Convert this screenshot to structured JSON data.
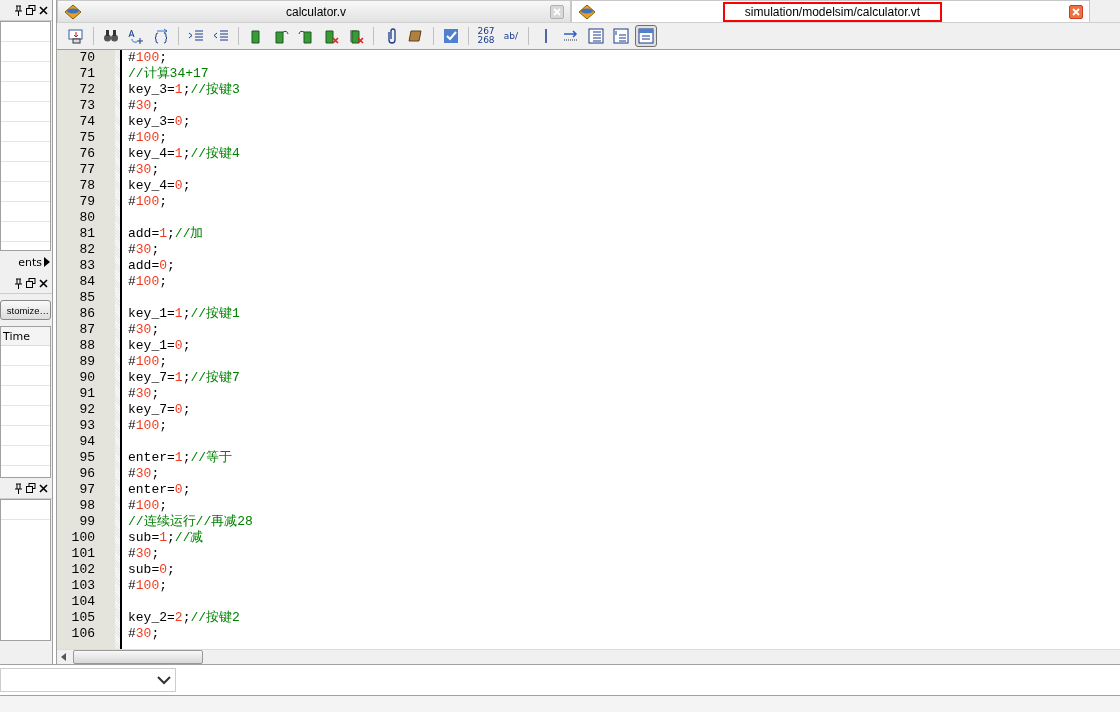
{
  "left_panel": {
    "tabs_fragment": "ents",
    "customize_button": "stomize…",
    "table_header": "Time"
  },
  "tabs": [
    {
      "label": "calculator.v",
      "selected": false,
      "outlined": false
    },
    {
      "label": "simulation/modelsim/calculator.vt",
      "selected": true,
      "outlined": true
    }
  ],
  "toolbar": [
    {
      "kind": "import"
    },
    {
      "kind": "sep"
    },
    {
      "kind": "find"
    },
    {
      "kind": "replace"
    },
    {
      "kind": "braces"
    },
    {
      "kind": "sep"
    },
    {
      "kind": "indent"
    },
    {
      "kind": "outdent"
    },
    {
      "kind": "sep"
    },
    {
      "kind": "bookmark"
    },
    {
      "kind": "bookmark-next"
    },
    {
      "kind": "bookmark-prev"
    },
    {
      "kind": "bookmark-delete"
    },
    {
      "kind": "bookmark-clear"
    },
    {
      "kind": "sep"
    },
    {
      "kind": "attach"
    },
    {
      "kind": "scroll"
    },
    {
      "kind": "sep"
    },
    {
      "kind": "check"
    },
    {
      "kind": "sep"
    },
    {
      "kind": "text",
      "label": "267\n268"
    },
    {
      "kind": "text",
      "label": "ab/"
    },
    {
      "kind": "sep"
    },
    {
      "kind": "bar"
    },
    {
      "kind": "arrow"
    },
    {
      "kind": "lines"
    },
    {
      "kind": "lines-numbered"
    },
    {
      "kind": "view",
      "selected": true
    }
  ],
  "code_lines": [
    {
      "number": "70",
      "tokens": [
        {
          "kind": "plain",
          "text": "#"
        },
        {
          "kind": "num",
          "text": "100"
        },
        {
          "kind": "plain",
          "text": ";"
        }
      ]
    },
    {
      "number": "71",
      "tokens": [
        {
          "kind": "comment",
          "text": "//计算34+17"
        }
      ]
    },
    {
      "number": "72",
      "tokens": [
        {
          "kind": "plain",
          "text": "key_3="
        },
        {
          "kind": "num",
          "text": "1"
        },
        {
          "kind": "plain",
          "text": ";"
        },
        {
          "kind": "comment",
          "text": "//按键3"
        }
      ]
    },
    {
      "number": "73",
      "tokens": [
        {
          "kind": "plain",
          "text": "#"
        },
        {
          "kind": "num",
          "text": "30"
        },
        {
          "kind": "plain",
          "text": ";"
        }
      ]
    },
    {
      "number": "74",
      "tokens": [
        {
          "kind": "plain",
          "text": "key_3="
        },
        {
          "kind": "num",
          "text": "0"
        },
        {
          "kind": "plain",
          "text": ";"
        }
      ]
    },
    {
      "number": "75",
      "tokens": [
        {
          "kind": "plain",
          "text": "#"
        },
        {
          "kind": "num",
          "text": "100"
        },
        {
          "kind": "plain",
          "text": ";"
        }
      ]
    },
    {
      "number": "76",
      "tokens": [
        {
          "kind": "plain",
          "text": "key_4="
        },
        {
          "kind": "num",
          "text": "1"
        },
        {
          "kind": "plain",
          "text": ";"
        },
        {
          "kind": "comment",
          "text": "//按键4"
        }
      ]
    },
    {
      "number": "77",
      "tokens": [
        {
          "kind": "plain",
          "text": "#"
        },
        {
          "kind": "num",
          "text": "30"
        },
        {
          "kind": "plain",
          "text": ";"
        }
      ]
    },
    {
      "number": "78",
      "tokens": [
        {
          "kind": "plain",
          "text": "key_4="
        },
        {
          "kind": "num",
          "text": "0"
        },
        {
          "kind": "plain",
          "text": ";"
        }
      ]
    },
    {
      "number": "79",
      "tokens": [
        {
          "kind": "plain",
          "text": "#"
        },
        {
          "kind": "num",
          "text": "100"
        },
        {
          "kind": "plain",
          "text": ";"
        }
      ]
    },
    {
      "number": "80"
    },
    {
      "number": "81",
      "tokens": [
        {
          "kind": "plain",
          "text": "add="
        },
        {
          "kind": "num",
          "text": "1"
        },
        {
          "kind": "plain",
          "text": ";"
        },
        {
          "kind": "comment",
          "text": "//加"
        }
      ]
    },
    {
      "number": "82",
      "tokens": [
        {
          "kind": "plain",
          "text": "#"
        },
        {
          "kind": "num",
          "text": "30"
        },
        {
          "kind": "plain",
          "text": ";"
        }
      ]
    },
    {
      "number": "83",
      "tokens": [
        {
          "kind": "plain",
          "text": "add="
        },
        {
          "kind": "num",
          "text": "0"
        },
        {
          "kind": "plain",
          "text": ";"
        }
      ]
    },
    {
      "number": "84",
      "tokens": [
        {
          "kind": "plain",
          "text": "#"
        },
        {
          "kind": "num",
          "text": "100"
        },
        {
          "kind": "plain",
          "text": ";"
        }
      ]
    },
    {
      "number": "85"
    },
    {
      "number": "86",
      "tokens": [
        {
          "kind": "plain",
          "text": "key_1="
        },
        {
          "kind": "num",
          "text": "1"
        },
        {
          "kind": "plain",
          "text": ";"
        },
        {
          "kind": "comment",
          "text": "//按键1"
        }
      ]
    },
    {
      "number": "87",
      "tokens": [
        {
          "kind": "plain",
          "text": "#"
        },
        {
          "kind": "num",
          "text": "30"
        },
        {
          "kind": "plain",
          "text": ";"
        }
      ]
    },
    {
      "number": "88",
      "tokens": [
        {
          "kind": "plain",
          "text": "key_1="
        },
        {
          "kind": "num",
          "text": "0"
        },
        {
          "kind": "plain",
          "text": ";"
        }
      ]
    },
    {
      "number": "89",
      "tokens": [
        {
          "kind": "plain",
          "text": "#"
        },
        {
          "kind": "num",
          "text": "100"
        },
        {
          "kind": "plain",
          "text": ";"
        }
      ]
    },
    {
      "number": "90",
      "tokens": [
        {
          "kind": "plain",
          "text": "key_7="
        },
        {
          "kind": "num",
          "text": "1"
        },
        {
          "kind": "plain",
          "text": ";"
        },
        {
          "kind": "comment",
          "text": "//按键7"
        }
      ]
    },
    {
      "number": "91",
      "tokens": [
        {
          "kind": "plain",
          "text": "#"
        },
        {
          "kind": "num",
          "text": "30"
        },
        {
          "kind": "plain",
          "text": ";"
        }
      ]
    },
    {
      "number": "92",
      "tokens": [
        {
          "kind": "plain",
          "text": "key_7="
        },
        {
          "kind": "num",
          "text": "0"
        },
        {
          "kind": "plain",
          "text": ";"
        }
      ]
    },
    {
      "number": "93",
      "tokens": [
        {
          "kind": "plain",
          "text": "#"
        },
        {
          "kind": "num",
          "text": "100"
        },
        {
          "kind": "plain",
          "text": ";"
        }
      ]
    },
    {
      "number": "94"
    },
    {
      "number": "95",
      "tokens": [
        {
          "kind": "plain",
          "text": "enter="
        },
        {
          "kind": "num",
          "text": "1"
        },
        {
          "kind": "plain",
          "text": ";"
        },
        {
          "kind": "comment",
          "text": "//等于"
        }
      ]
    },
    {
      "number": "96",
      "tokens": [
        {
          "kind": "plain",
          "text": "#"
        },
        {
          "kind": "num",
          "text": "30"
        },
        {
          "kind": "plain",
          "text": ";"
        }
      ]
    },
    {
      "number": "97",
      "tokens": [
        {
          "kind": "plain",
          "text": "enter="
        },
        {
          "kind": "num",
          "text": "0"
        },
        {
          "kind": "plain",
          "text": ";"
        }
      ]
    },
    {
      "number": "98",
      "tokens": [
        {
          "kind": "plain",
          "text": "#"
        },
        {
          "kind": "num",
          "text": "100"
        },
        {
          "kind": "plain",
          "text": ";"
        }
      ]
    },
    {
      "number": "99",
      "tokens": [
        {
          "kind": "comment",
          "text": "//连续运行//再减28"
        }
      ]
    },
    {
      "number": "100",
      "tokens": [
        {
          "kind": "plain",
          "text": "sub="
        },
        {
          "kind": "num",
          "text": "1"
        },
        {
          "kind": "plain",
          "text": ";"
        },
        {
          "kind": "comment",
          "text": "//减"
        }
      ]
    },
    {
      "number": "101",
      "tokens": [
        {
          "kind": "plain",
          "text": "#"
        },
        {
          "kind": "num",
          "text": "30"
        },
        {
          "kind": "plain",
          "text": ";"
        }
      ]
    },
    {
      "number": "102",
      "tokens": [
        {
          "kind": "plain",
          "text": "sub="
        },
        {
          "kind": "num",
          "text": "0"
        },
        {
          "kind": "plain",
          "text": ";"
        }
      ]
    },
    {
      "number": "103",
      "tokens": [
        {
          "kind": "plain",
          "text": "#"
        },
        {
          "kind": "num",
          "text": "100"
        },
        {
          "kind": "plain",
          "text": ";"
        }
      ]
    },
    {
      "number": "104"
    },
    {
      "number": "105",
      "tokens": [
        {
          "kind": "plain",
          "text": "key_2="
        },
        {
          "kind": "num",
          "text": "2"
        },
        {
          "kind": "plain",
          "text": ";"
        },
        {
          "kind": "comment",
          "text": "//按键2"
        }
      ]
    },
    {
      "number": "106",
      "tokens": [
        {
          "kind": "plain",
          "text": "#"
        },
        {
          "kind": "num",
          "text": "30"
        },
        {
          "kind": "plain",
          "text": ";"
        }
      ]
    }
  ]
}
